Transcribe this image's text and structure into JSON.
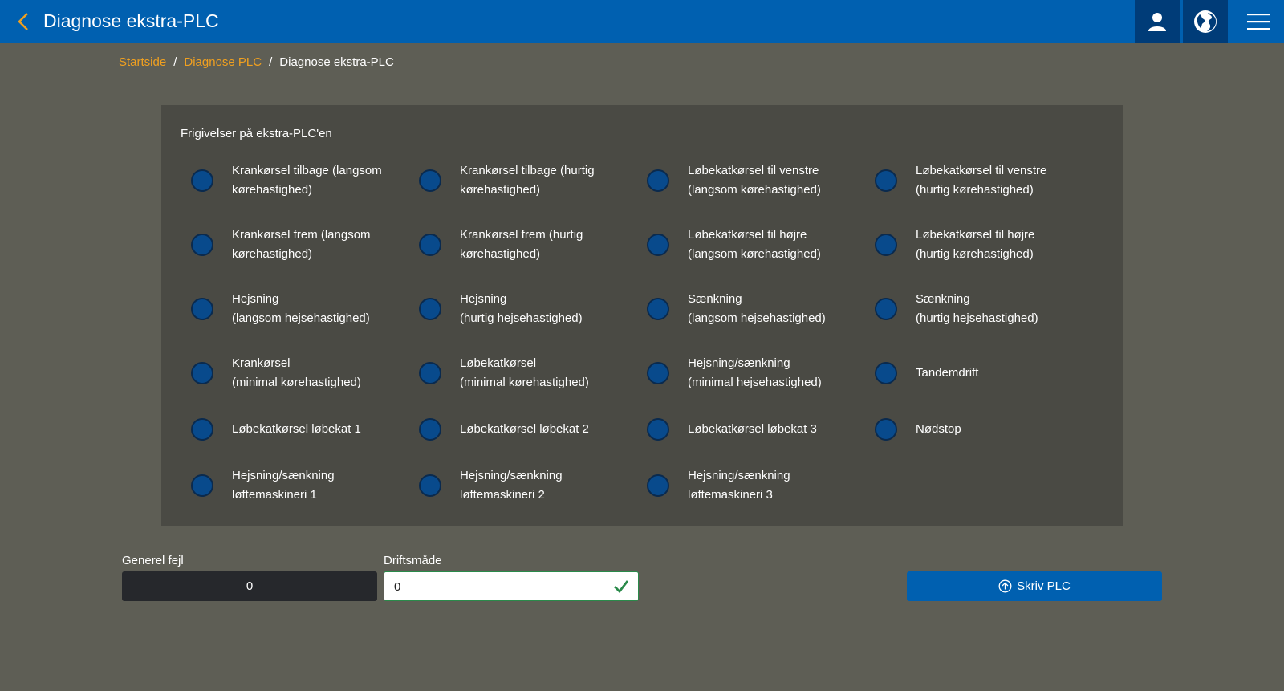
{
  "header": {
    "title": "Diagnose ekstra-PLC",
    "back_icon": "chevron-left-icon",
    "user_icon": "user-icon",
    "globe_icon": "globe-icon",
    "menu_icon": "hamburger-menu-icon"
  },
  "breadcrumb": {
    "items": [
      "Startside",
      "Diagnose PLC"
    ],
    "current": "Diagnose ekstra-PLC",
    "separator": "/"
  },
  "panel": {
    "title": "Frigivelser på ekstra-PLC'en",
    "items": [
      "Krankørsel tilbage (langsom\nkørehastighed)",
      "Krankørsel tilbage (hurtig\nkørehastighed)",
      "Løbekatkørsel til venstre\n(langsom kørehastighed)",
      "Løbekatkørsel til venstre\n(hurtig kørehastighed)",
      "Krankørsel frem (langsom\nkørehastighed)",
      "Krankørsel frem (hurtig\nkørehastighed)",
      "Løbekatkørsel til højre\n(langsom kørehastighed)",
      "Løbekatkørsel til højre\n(hurtig kørehastighed)",
      "Hejsning\n(langsom hejsehastighed)",
      "Hejsning\n(hurtig hejsehastighed)",
      "Sænkning\n(langsom hejsehastighed)",
      "Sænkning\n(hurtig hejsehastighed)",
      "Krankørsel\n(minimal kørehastighed)",
      "Løbekatkørsel\n(minimal kørehastighed)",
      "Hejsning/sænkning\n(minimal hejsehastighed)",
      "Tandemdrift",
      "Løbekatkørsel løbekat 1",
      "Løbekatkørsel løbekat 2",
      "Løbekatkørsel løbekat 3",
      "Nødstop",
      "Hejsning/sænkning\nløftemaskineri 1",
      "Hejsning/sænkning\nløftemaskineri 2",
      "Hejsning/sænkning\nløftemaskineri 3"
    ],
    "indicator_color": "#084a8c"
  },
  "fields": {
    "general_error": {
      "label": "Generel fejl",
      "value": "0"
    },
    "operation_mode": {
      "label": "Driftsmåde",
      "value": "0",
      "check_icon": "checkmark-icon"
    }
  },
  "actions": {
    "write_plc": {
      "label": "Skriv PLC",
      "icon": "upload-circle-icon"
    }
  },
  "colors": {
    "header": "#0060b0",
    "background": "#5e5e55",
    "panel": "#4a4a44",
    "link": "#f0a020",
    "check": "#2a8a4a"
  }
}
